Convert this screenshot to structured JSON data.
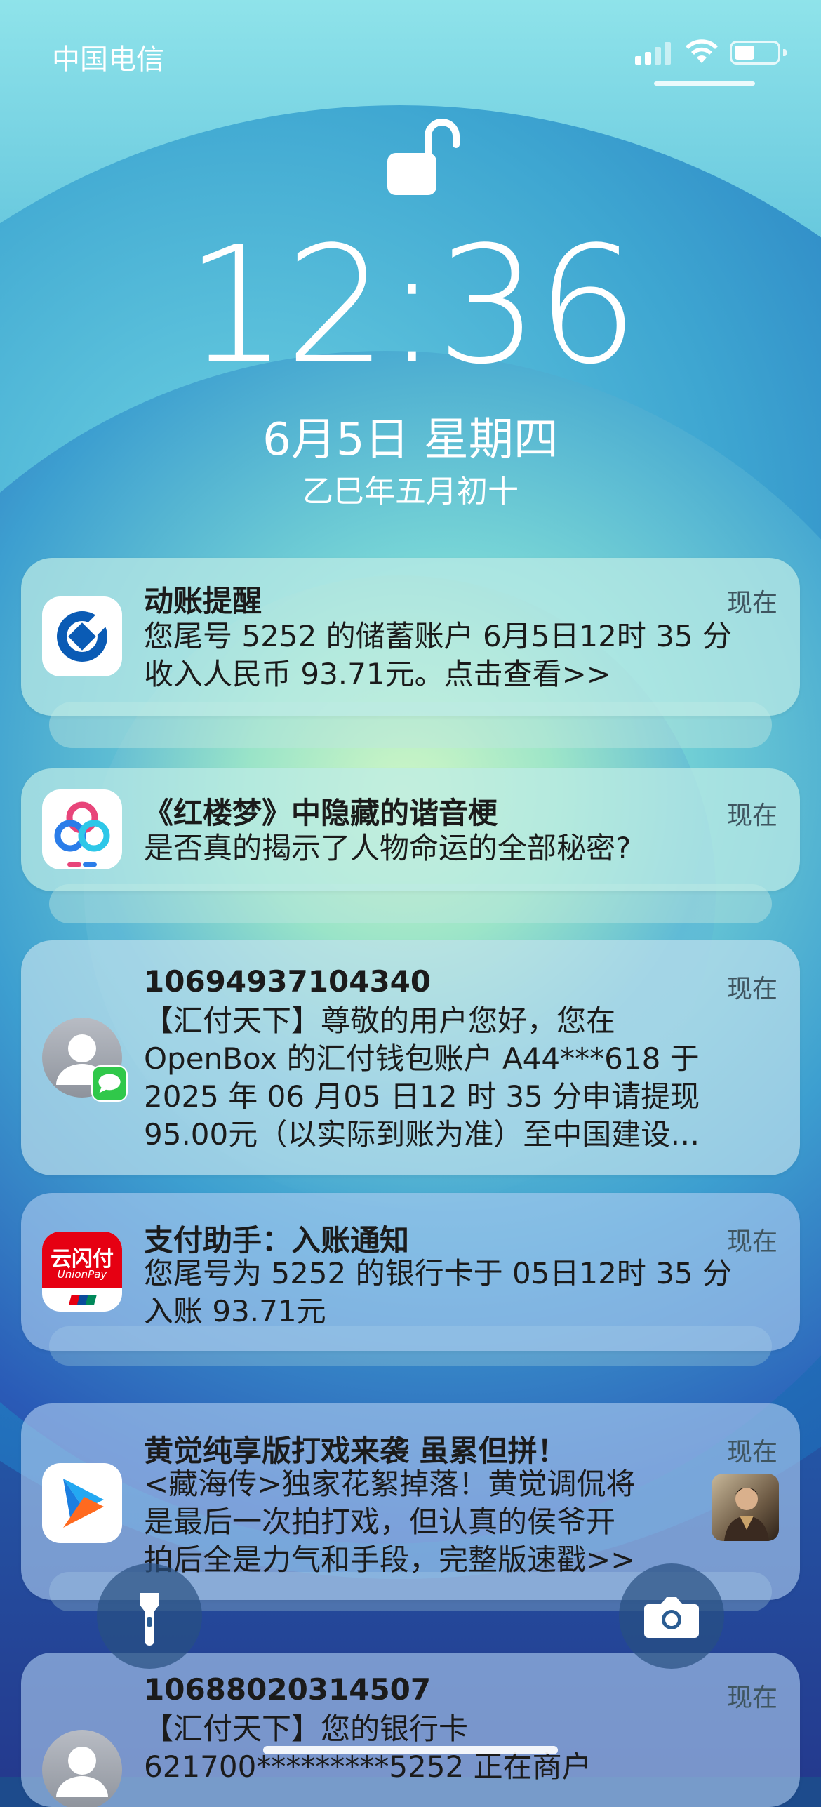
{
  "status_bar": {
    "carrier": "中国电信",
    "battery_level": 0.5
  },
  "lock_screen": {
    "time": "12:36",
    "date": "6月5日 星期四",
    "lunar_date": "乙巳年五月初十"
  },
  "notifications": [
    {
      "title": "动账提醒",
      "time": "现在",
      "body_lines": [
        "您尾号 5252 的储蓄账户 6月5日12时 35 分",
        "收入人民币 93.71元。点击查看>>"
      ],
      "icon": "ccb-bank-icon",
      "icon_color": "#0a5bb5"
    },
    {
      "title": "《红楼梦》中隐藏的谐音梗",
      "time": "现在",
      "body_lines": [
        "是否真的揭示了人物命运的全部秘密?"
      ],
      "icon": "baidu-app-icon"
    },
    {
      "title": "10694937104340",
      "time": "现在",
      "body_lines": [
        "【汇付天下】尊敬的用户您好，您在",
        "OpenBox 的汇付钱包账户 A44***618 于",
        "2025 年 06 月05 日12 时 35 分申请提现",
        "95.00元（以实际到账为准）至中国建设…"
      ],
      "icon": "contact-avatar-icon",
      "badge": "messages-badge-icon"
    },
    {
      "title": "支付助手：入账通知",
      "time": "现在",
      "body_lines": [
        "您尾号为 5252 的银行卡于 05日12时 35 分",
        "入账 93.71元"
      ],
      "icon": "unionpay-quickpass-icon",
      "icon_text": "云闪付",
      "icon_subtext": "UnionPay",
      "icon_color": "#e60012"
    },
    {
      "title": "黄觉纯享版打戏来袭 虽累但拼！",
      "time": "现在",
      "body_lines": [
        "<藏海传>独家花絮掉落！黄觉调侃将",
        "是最后一次拍打戏，但认真的侯爷开",
        "拍后全是力气和手段，完整版速戳>>"
      ],
      "icon": "youku-video-icon",
      "thumbnail": "actor-thumbnail"
    },
    {
      "title": "10688020314507",
      "time": "现在",
      "body_lines": [
        "【汇付天下】您的银行卡",
        "621700*********5252 正在商户"
      ],
      "icon": "contact-avatar-icon"
    }
  ],
  "quick_actions": {
    "left": "flashlight-icon",
    "right": "camera-icon"
  }
}
